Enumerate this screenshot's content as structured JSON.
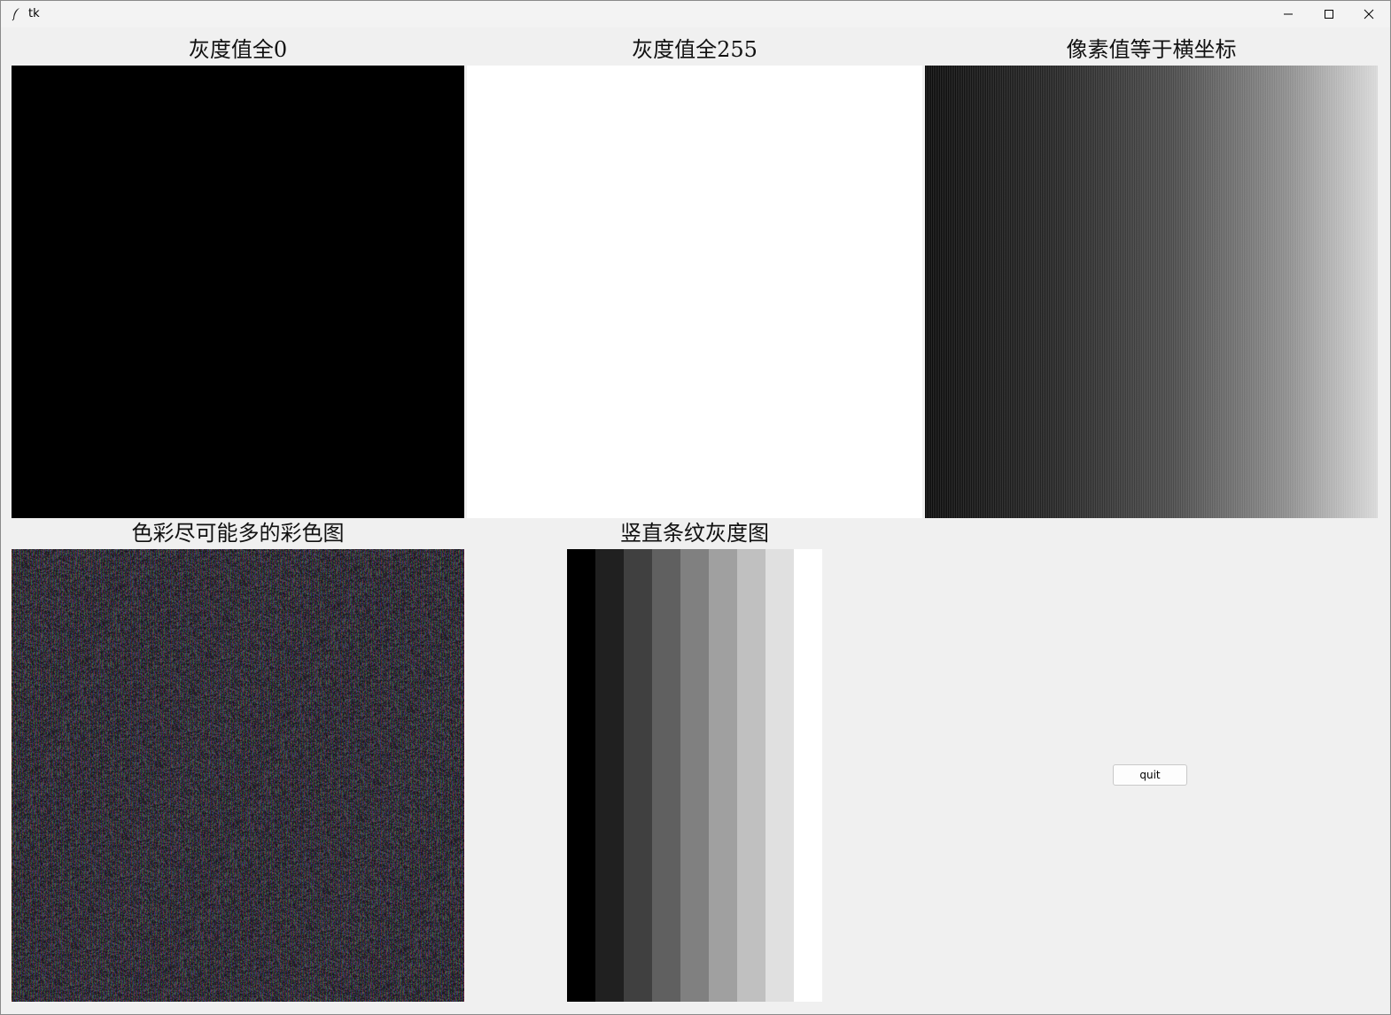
{
  "window": {
    "title": "tk"
  },
  "captions": {
    "black": "灰度值全0",
    "white": "灰度值全255",
    "gradient": "像素值等于横坐标",
    "color": "色彩尽可能多的彩色图",
    "stripes": "竖直条纹灰度图"
  },
  "panels": {
    "black": {
      "gray_value": 0
    },
    "white": {
      "gray_value": 255
    },
    "gradient": {
      "description_values": "pixel value equals x coordinate"
    },
    "stripes": {
      "colors": [
        "#000000",
        "#202020",
        "#404040",
        "#606060",
        "#808080",
        "#a0a0a0",
        "#c0c0c0",
        "#e0e0e0",
        "#ffffff"
      ]
    }
  },
  "buttons": {
    "quit": "quit"
  },
  "icons": {
    "app": "tk-feather-icon",
    "minimize": "minimize-icon",
    "maximize": "maximize-icon",
    "close": "close-icon"
  }
}
